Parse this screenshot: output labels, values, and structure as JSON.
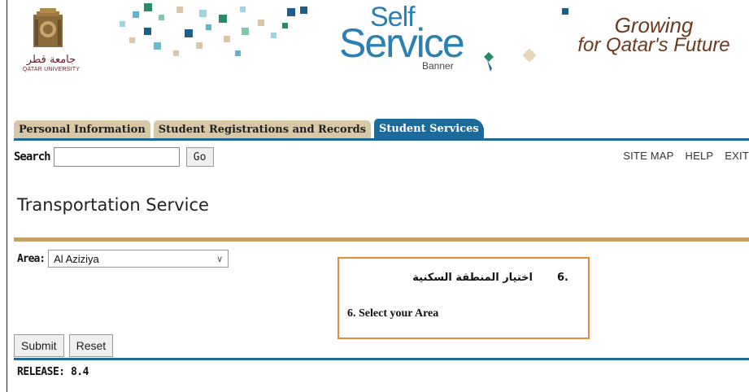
{
  "header": {
    "university_name_ar": "جامعة قطر",
    "university_name_en": "QATAR UNIVERSITY",
    "logo_self": "Self",
    "logo_service": "Service",
    "logo_banner": "Banner",
    "slogan_line1": "Growing",
    "slogan_line2": "for Qatar's Future"
  },
  "tabs": [
    {
      "label": "Personal Information",
      "active": false
    },
    {
      "label": "Student Registrations and Records",
      "active": false
    },
    {
      "label": "Student Services",
      "active": true
    }
  ],
  "search": {
    "label": "Search",
    "value": "",
    "go_label": "Go"
  },
  "toplinks": {
    "site_map": "SITE MAP",
    "help": "HELP",
    "exit": "EXIT"
  },
  "page": {
    "title": "Transportation Service"
  },
  "form": {
    "area_label": "Area:",
    "area_selected": "Al Aziziya",
    "submit_label": "Submit",
    "reset_label": "Reset"
  },
  "callout": {
    "step_number_ar": ".6",
    "text_ar": "اختيار المنطقة السكنية",
    "text_en": "6. Select your Area"
  },
  "footer": {
    "release": "RELEASE: 8.4"
  },
  "colors": {
    "tab_active": "#1d6a9a",
    "tab_inactive": "#d8c8a8",
    "rule_brown": "#c8a06a",
    "callout_border": "#e48a3a",
    "logo_blue": "#2b7fb2"
  }
}
